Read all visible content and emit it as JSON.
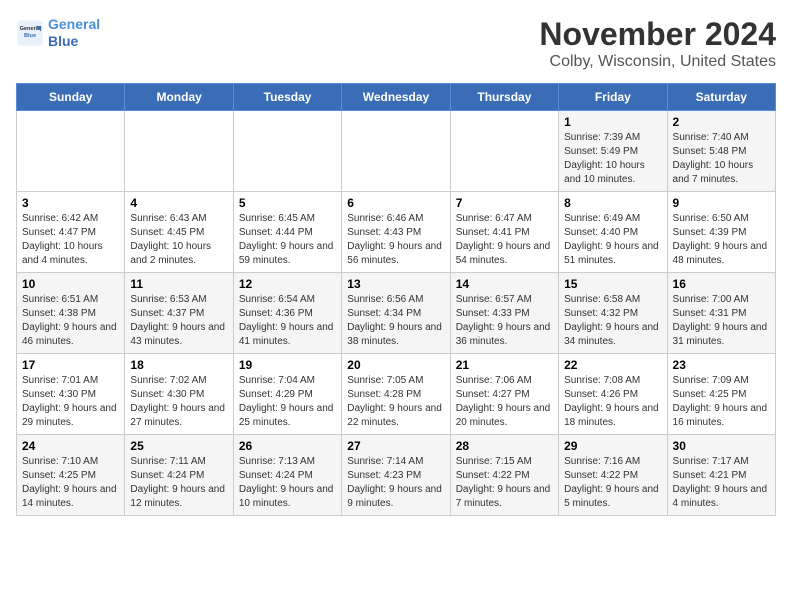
{
  "logo": {
    "line1": "General",
    "line2": "Blue"
  },
  "title": "November 2024",
  "subtitle": "Colby, Wisconsin, United States",
  "header_color": "#3a6db5",
  "days_of_week": [
    "Sunday",
    "Monday",
    "Tuesday",
    "Wednesday",
    "Thursday",
    "Friday",
    "Saturday"
  ],
  "weeks": [
    [
      {
        "day": "",
        "info": ""
      },
      {
        "day": "",
        "info": ""
      },
      {
        "day": "",
        "info": ""
      },
      {
        "day": "",
        "info": ""
      },
      {
        "day": "",
        "info": ""
      },
      {
        "day": "1",
        "info": "Sunrise: 7:39 AM\nSunset: 5:49 PM\nDaylight: 10 hours and 10 minutes."
      },
      {
        "day": "2",
        "info": "Sunrise: 7:40 AM\nSunset: 5:48 PM\nDaylight: 10 hours and 7 minutes."
      }
    ],
    [
      {
        "day": "3",
        "info": "Sunrise: 6:42 AM\nSunset: 4:47 PM\nDaylight: 10 hours and 4 minutes."
      },
      {
        "day": "4",
        "info": "Sunrise: 6:43 AM\nSunset: 4:45 PM\nDaylight: 10 hours and 2 minutes."
      },
      {
        "day": "5",
        "info": "Sunrise: 6:45 AM\nSunset: 4:44 PM\nDaylight: 9 hours and 59 minutes."
      },
      {
        "day": "6",
        "info": "Sunrise: 6:46 AM\nSunset: 4:43 PM\nDaylight: 9 hours and 56 minutes."
      },
      {
        "day": "7",
        "info": "Sunrise: 6:47 AM\nSunset: 4:41 PM\nDaylight: 9 hours and 54 minutes."
      },
      {
        "day": "8",
        "info": "Sunrise: 6:49 AM\nSunset: 4:40 PM\nDaylight: 9 hours and 51 minutes."
      },
      {
        "day": "9",
        "info": "Sunrise: 6:50 AM\nSunset: 4:39 PM\nDaylight: 9 hours and 48 minutes."
      }
    ],
    [
      {
        "day": "10",
        "info": "Sunrise: 6:51 AM\nSunset: 4:38 PM\nDaylight: 9 hours and 46 minutes."
      },
      {
        "day": "11",
        "info": "Sunrise: 6:53 AM\nSunset: 4:37 PM\nDaylight: 9 hours and 43 minutes."
      },
      {
        "day": "12",
        "info": "Sunrise: 6:54 AM\nSunset: 4:36 PM\nDaylight: 9 hours and 41 minutes."
      },
      {
        "day": "13",
        "info": "Sunrise: 6:56 AM\nSunset: 4:34 PM\nDaylight: 9 hours and 38 minutes."
      },
      {
        "day": "14",
        "info": "Sunrise: 6:57 AM\nSunset: 4:33 PM\nDaylight: 9 hours and 36 minutes."
      },
      {
        "day": "15",
        "info": "Sunrise: 6:58 AM\nSunset: 4:32 PM\nDaylight: 9 hours and 34 minutes."
      },
      {
        "day": "16",
        "info": "Sunrise: 7:00 AM\nSunset: 4:31 PM\nDaylight: 9 hours and 31 minutes."
      }
    ],
    [
      {
        "day": "17",
        "info": "Sunrise: 7:01 AM\nSunset: 4:30 PM\nDaylight: 9 hours and 29 minutes."
      },
      {
        "day": "18",
        "info": "Sunrise: 7:02 AM\nSunset: 4:30 PM\nDaylight: 9 hours and 27 minutes."
      },
      {
        "day": "19",
        "info": "Sunrise: 7:04 AM\nSunset: 4:29 PM\nDaylight: 9 hours and 25 minutes."
      },
      {
        "day": "20",
        "info": "Sunrise: 7:05 AM\nSunset: 4:28 PM\nDaylight: 9 hours and 22 minutes."
      },
      {
        "day": "21",
        "info": "Sunrise: 7:06 AM\nSunset: 4:27 PM\nDaylight: 9 hours and 20 minutes."
      },
      {
        "day": "22",
        "info": "Sunrise: 7:08 AM\nSunset: 4:26 PM\nDaylight: 9 hours and 18 minutes."
      },
      {
        "day": "23",
        "info": "Sunrise: 7:09 AM\nSunset: 4:25 PM\nDaylight: 9 hours and 16 minutes."
      }
    ],
    [
      {
        "day": "24",
        "info": "Sunrise: 7:10 AM\nSunset: 4:25 PM\nDaylight: 9 hours and 14 minutes."
      },
      {
        "day": "25",
        "info": "Sunrise: 7:11 AM\nSunset: 4:24 PM\nDaylight: 9 hours and 12 minutes."
      },
      {
        "day": "26",
        "info": "Sunrise: 7:13 AM\nSunset: 4:24 PM\nDaylight: 9 hours and 10 minutes."
      },
      {
        "day": "27",
        "info": "Sunrise: 7:14 AM\nSunset: 4:23 PM\nDaylight: 9 hours and 9 minutes."
      },
      {
        "day": "28",
        "info": "Sunrise: 7:15 AM\nSunset: 4:22 PM\nDaylight: 9 hours and 7 minutes."
      },
      {
        "day": "29",
        "info": "Sunrise: 7:16 AM\nSunset: 4:22 PM\nDaylight: 9 hours and 5 minutes."
      },
      {
        "day": "30",
        "info": "Sunrise: 7:17 AM\nSunset: 4:21 PM\nDaylight: 9 hours and 4 minutes."
      }
    ]
  ]
}
